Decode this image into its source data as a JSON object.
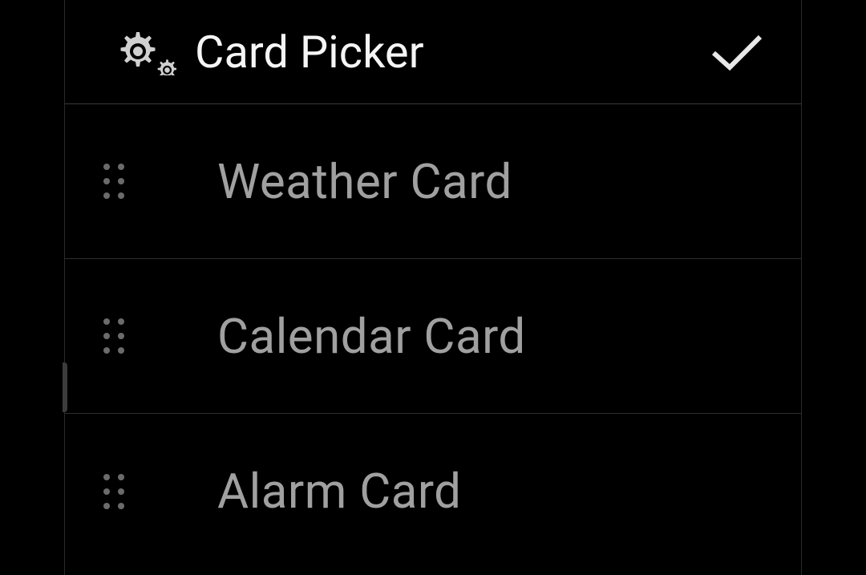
{
  "header": {
    "title": "Card Picker"
  },
  "rows": [
    {
      "label": "Weather Card"
    },
    {
      "label": "Calendar Card"
    },
    {
      "label": "Alarm Card"
    }
  ]
}
